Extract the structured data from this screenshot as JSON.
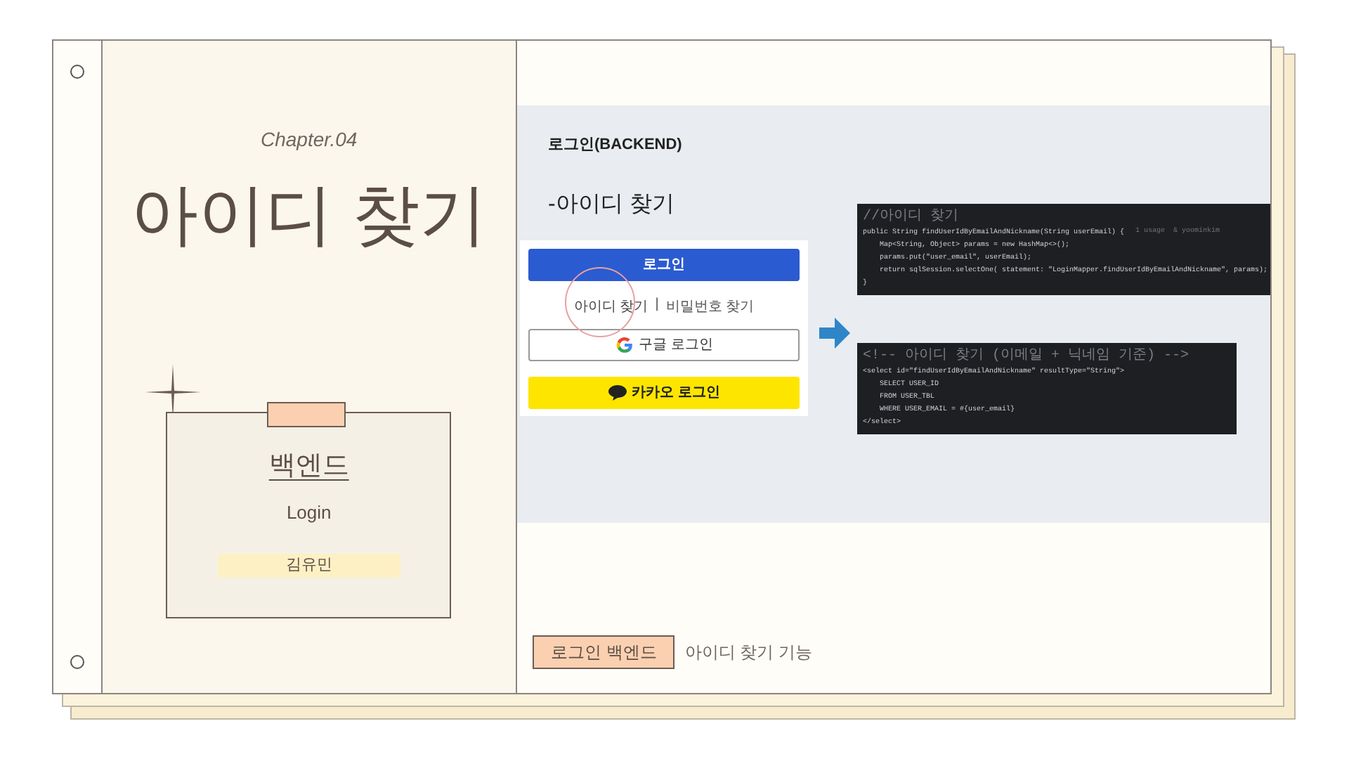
{
  "cover": {
    "chapter": "Chapter.04",
    "title": "아이디 찾기",
    "card": {
      "heading": "백엔드",
      "subtitle": "Login",
      "author": "김유민"
    }
  },
  "slide": {
    "heading": "로그인(BACKEND)",
    "subheading": "-아이디 찾기",
    "login_form": {
      "login_button": "로그인",
      "links": [
        {
          "label": "아이디 찾기",
          "selected": true
        },
        {
          "label": "비밀번호 찾기",
          "selected": false
        }
      ],
      "separator": "|",
      "google_button": "구글 로그인",
      "kakao_button": "카카오 로그인"
    },
    "code_blocks": [
      {
        "kind": "java",
        "lines": [
          {
            "kind": "comment",
            "text": "//아이디 찾기"
          },
          {
            "kind": "code",
            "text": "public String findUserIdByEmailAndNickname(String userEmail) {",
            "hint": "1 usage  & yoominkim"
          },
          {
            "kind": "code",
            "text": "    Map<String, Object> params = new HashMap<>();"
          },
          {
            "kind": "code",
            "text": "    params.put(\"user_email\", userEmail);"
          },
          {
            "kind": "code",
            "text": "    return sqlSession.selectOne( statement: \"LoginMapper.findUserIdByEmailAndNickname\", params);"
          },
          {
            "kind": "code",
            "text": "}"
          }
        ]
      },
      {
        "kind": "xml",
        "lines": [
          {
            "kind": "comment",
            "text": "<!-- 아이디 찾기 (이메일 + 닉네임 기준) -->"
          },
          {
            "kind": "code",
            "text": "<select id=\"findUserIdByEmailAndNickname\" resultType=\"String\">"
          },
          {
            "kind": "code",
            "text": "    SELECT USER_ID"
          },
          {
            "kind": "code",
            "text": "    FROM USER_TBL"
          },
          {
            "kind": "code",
            "text": "    WHERE USER_EMAIL = #{user_email}"
          },
          {
            "kind": "code",
            "text": "</select>"
          }
        ]
      }
    ]
  },
  "footer": {
    "tag": "로그인 백엔드",
    "caption": "아이디 찾기 기능"
  }
}
